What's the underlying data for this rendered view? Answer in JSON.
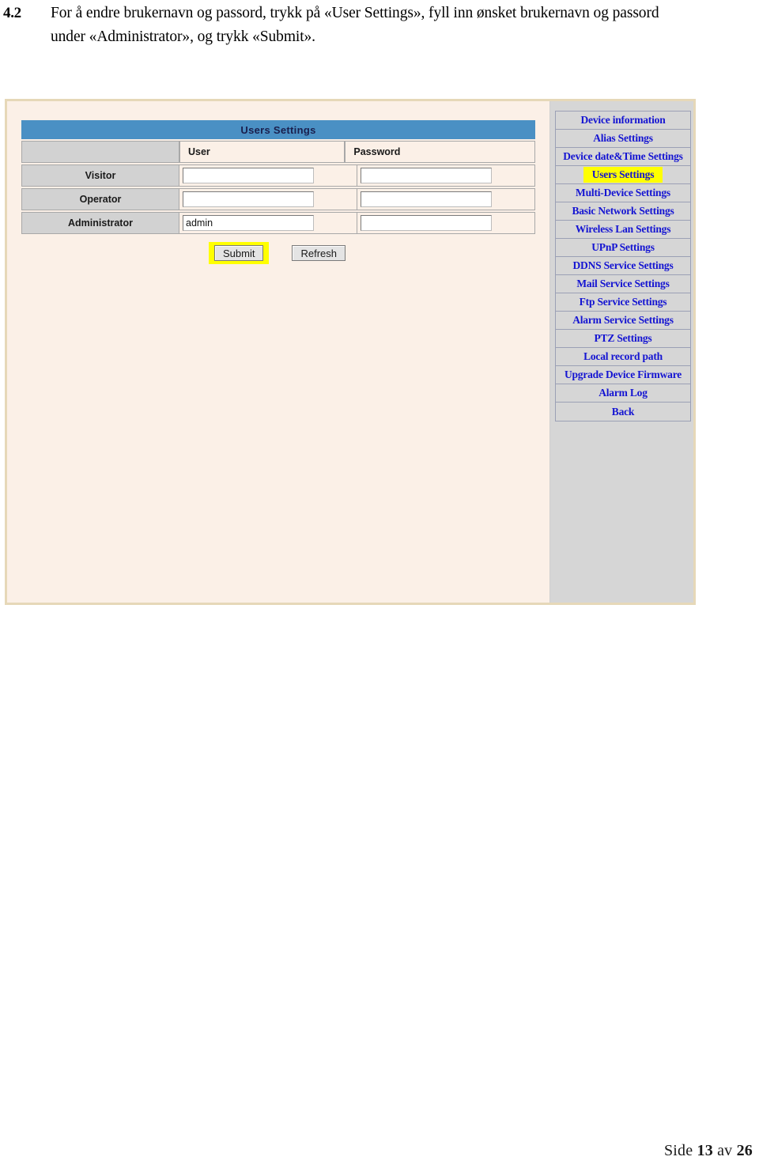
{
  "document": {
    "section_number": "4.2",
    "instruction_line1": "For å endre brukernavn og passord, trykk på «User Settings», fyll inn ønsket brukernavn og passord",
    "instruction_line2": "under «Administrator», og trykk «Submit»."
  },
  "footer": {
    "prefix": "Side",
    "current_page": "13",
    "middle": "av",
    "total_pages": "26"
  },
  "camera_ui": {
    "panel": {
      "title": "Users Settings",
      "title_bar_color": "#4a90c4",
      "content_bg": "#fbf0e7",
      "menu_bg": "#d6d6d6",
      "frame_border_color": "#e6d8b8",
      "highlight_color": "#ffff00",
      "menu_link_color": "#1414d2"
    },
    "table": {
      "columns": [
        "",
        "User",
        "Password"
      ],
      "rows": [
        {
          "role": "Visitor",
          "user": "",
          "password": ""
        },
        {
          "role": "Operator",
          "user": "",
          "password": ""
        },
        {
          "role": "Administrator",
          "user": "admin",
          "password": ""
        }
      ]
    },
    "buttons": {
      "submit": "Submit",
      "refresh": "Refresh"
    },
    "menu": {
      "items": [
        {
          "label": "Device information",
          "active": false
        },
        {
          "label": "Alias Settings",
          "active": false
        },
        {
          "label": "Device date&Time Settings",
          "active": false
        },
        {
          "label": "Users Settings",
          "active": true
        },
        {
          "label": "Multi-Device Settings",
          "active": false
        },
        {
          "label": "Basic Network Settings",
          "active": false
        },
        {
          "label": "Wireless Lan Settings",
          "active": false
        },
        {
          "label": "UPnP Settings",
          "active": false
        },
        {
          "label": "DDNS Service Settings",
          "active": false
        },
        {
          "label": "Mail Service Settings",
          "active": false
        },
        {
          "label": "Ftp Service Settings",
          "active": false
        },
        {
          "label": "Alarm Service Settings",
          "active": false
        },
        {
          "label": "PTZ Settings",
          "active": false
        },
        {
          "label": "Local record path",
          "active": false
        },
        {
          "label": "Upgrade Device Firmware",
          "active": false
        },
        {
          "label": "Alarm Log",
          "active": false
        },
        {
          "label": "Back",
          "active": false
        }
      ]
    }
  }
}
